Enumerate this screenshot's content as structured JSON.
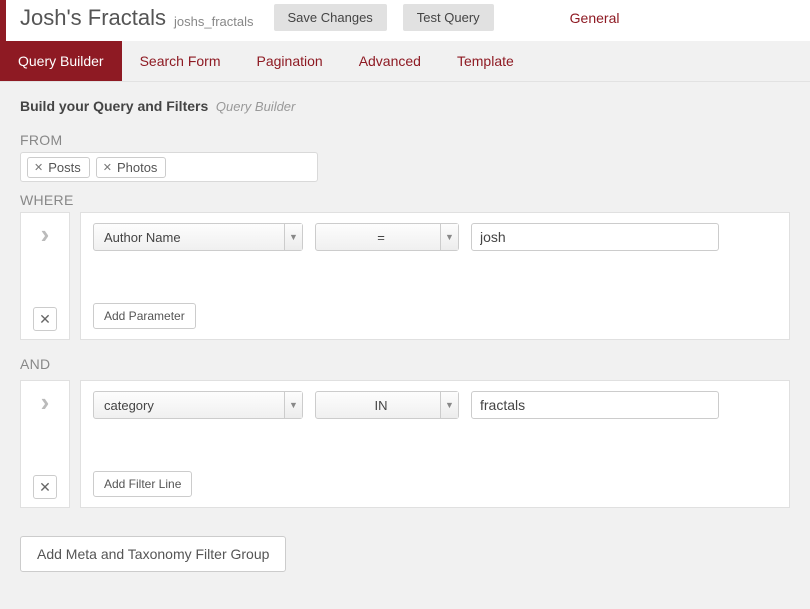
{
  "header": {
    "title": "Josh's Fractals",
    "slug": "joshs_fractals",
    "save_label": "Save Changes",
    "test_label": "Test Query",
    "general_link": "General"
  },
  "tabs": [
    {
      "label": "Query Builder",
      "active": true
    },
    {
      "label": "Search Form",
      "active": false
    },
    {
      "label": "Pagination",
      "active": false
    },
    {
      "label": "Advanced",
      "active": false
    },
    {
      "label": "Template",
      "active": false
    }
  ],
  "build": {
    "label": "Build your Query and Filters",
    "sub": "Query Builder"
  },
  "from": {
    "keyword": "FROM",
    "tokens": [
      "Posts",
      "Photos"
    ]
  },
  "where": {
    "keyword": "WHERE",
    "field": "Author Name",
    "operator": "=",
    "value": "josh",
    "add_label": "Add Parameter"
  },
  "and": {
    "keyword": "AND",
    "field": "category",
    "operator": "IN",
    "value": "fractals",
    "add_label": "Add Filter Line"
  },
  "meta_btn": "Add Meta and Taxonomy Filter Group"
}
